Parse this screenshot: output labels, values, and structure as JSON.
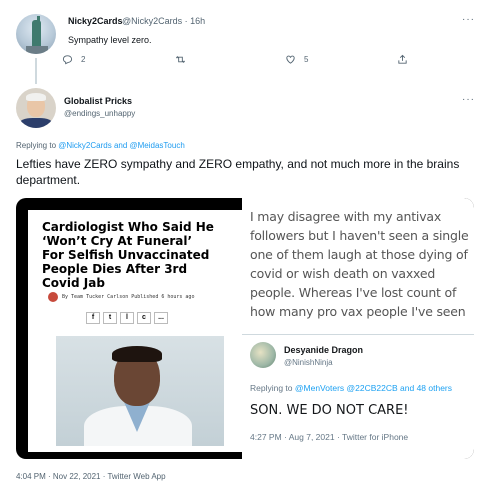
{
  "reply_context": {
    "name": "Nicky2Cards",
    "handle": "@Nicky2Cards · 16h",
    "text": "Sympathy level zero.",
    "replies": "2",
    "retweets": "",
    "likes": "5"
  },
  "tweet": {
    "name": "Globalist Pricks",
    "handle": "@endings_unhappy",
    "replying_prefix": "Replying to ",
    "replying_users": "@Nicky2Cards and @MeidasTouch",
    "text": "Lefties have ZERO sympathy and ZERO empathy, and not much more in the brains department.",
    "timestamp": "4:04 PM · Nov 22, 2021 · Twitter Web App"
  },
  "media": {
    "article": {
      "headline": "Cardiologist Who Said He ‘Won’t Cry At Funeral’ For Selfish Unvaccinated People Dies After 3rd Covid Jab",
      "byline": "By Team Tucker Carlson Published 6 hours ago",
      "share_icons": [
        "f",
        "t",
        "l",
        "c",
        "..."
      ]
    },
    "quoted_tweet": {
      "text": "I may disagree with my antivax followers but I haven't seen a single one of them laugh at those dying of covid or wish death on vaxxed people. Whereas I've lost count of how many pro vax people I've seen",
      "name": "Desyanide Dragon",
      "handle": "@NinishNinja",
      "replying_prefix": "Replying to ",
      "replying_users": "@MenVoters @22CB22CB and 48 others",
      "body": "SON. WE DO NOT CARE!",
      "time": "4:27 PM · Aug 7, 2021 · Twitter for iPhone"
    }
  },
  "icons": {
    "more": "more-icon",
    "reply": "reply-icon",
    "retweet": "retweet-icon",
    "like": "like-icon",
    "share": "share-icon"
  },
  "colors": {
    "link": "#1d9bf0",
    "muted": "#536471",
    "text": "#0f1419"
  }
}
